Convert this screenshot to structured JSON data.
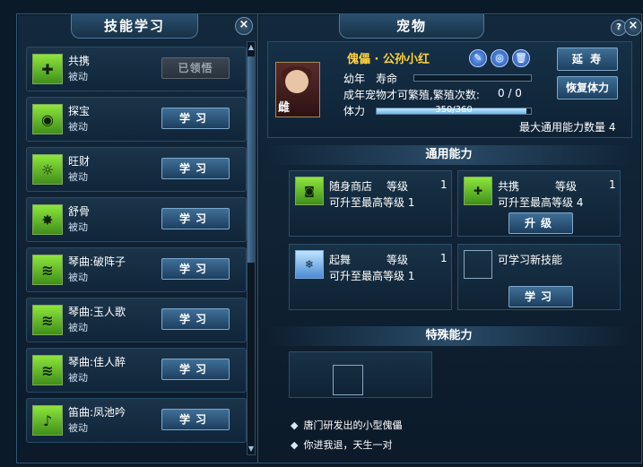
{
  "left_panel": {
    "title": "技能学习",
    "close_label": "×",
    "skills": [
      {
        "name": "共携",
        "type": "被动",
        "button": "已领悟",
        "button_enabled": false,
        "icon": "sack-plus-icon"
      },
      {
        "name": "探宝",
        "type": "被动",
        "button": "学习",
        "button_enabled": true,
        "icon": "eye-icon"
      },
      {
        "name": "旺财",
        "type": "被动",
        "button": "学习",
        "button_enabled": true,
        "icon": "sun-moon-icon"
      },
      {
        "name": "舒骨",
        "type": "被动",
        "button": "学习",
        "button_enabled": true,
        "icon": "burst-icon"
      },
      {
        "name": "琴曲:破阵子",
        "type": "被动",
        "button": "学习",
        "button_enabled": true,
        "icon": "zither-icon"
      },
      {
        "name": "琴曲:玉人歌",
        "type": "被动",
        "button": "学习",
        "button_enabled": true,
        "icon": "zither-icon"
      },
      {
        "name": "琴曲:佳人醉",
        "type": "被动",
        "button": "学习",
        "button_enabled": true,
        "icon": "zither-icon"
      },
      {
        "name": "笛曲:凤池吟",
        "type": "被动",
        "button": "学习",
        "button_enabled": true,
        "icon": "flute-icon"
      }
    ]
  },
  "right_panel": {
    "title": "宠物",
    "help_label": "?",
    "close_label": "×",
    "pet": {
      "name": "傀儡 · 公孙小红",
      "gender": "雌",
      "life_label": "幼年",
      "lifespan_label": "寿命",
      "lifespan_fraction": 0.0,
      "breed_label": "成年宠物才可繁殖,繁殖次数:",
      "breed_count": "0 / 0",
      "hp_label": "体力",
      "hp_text": "350/360",
      "hp_fraction": 0.972,
      "btn_extend": "延  寿",
      "btn_restore": "恢复体力",
      "max_abilities": "最大通用能力数量 4"
    },
    "common_title": "通用能力",
    "abilities": [
      {
        "name": "随身商店",
        "level_label": "等级",
        "level": "1",
        "sub": "可升至最高等级 1",
        "icon": "coin-icon"
      },
      {
        "name": "共携",
        "level_label": "等级",
        "level": "1",
        "sub": "可升至最高等级 4",
        "icon": "sack-plus-icon",
        "button": "升级"
      },
      {
        "name": "起舞",
        "level_label": "等级",
        "level": "1",
        "sub": "可升至最高等级 1",
        "icon": "dance-icon"
      },
      {
        "name": "可学习新技能",
        "button": "学习"
      }
    ],
    "special_title": "特殊能力",
    "notes": [
      "唐门研发出的小型傀儡",
      "你进我退，天生一对"
    ]
  }
}
